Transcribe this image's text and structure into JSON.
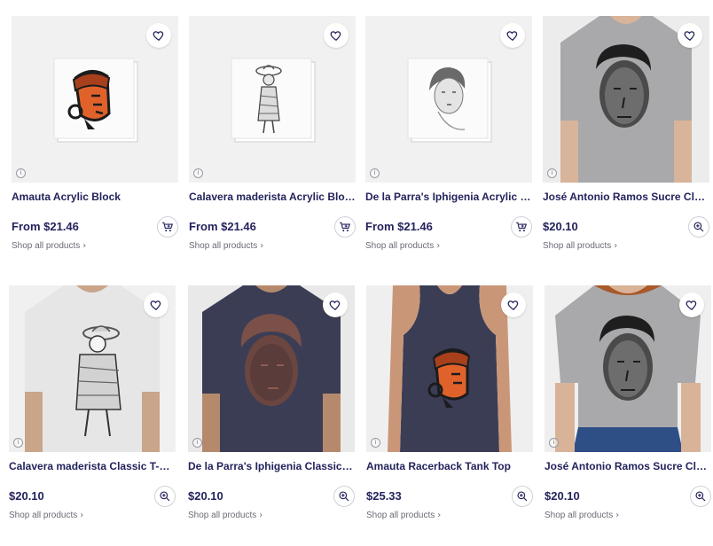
{
  "products": [
    {
      "title": "Amauta Acrylic Block",
      "price": "From $21.46",
      "link": "Shop all products",
      "action_icon": "cart-icon",
      "favorite_icon": "heart-icon",
      "info_icon": "info-icon",
      "info_glyph": "i",
      "chevron": "›",
      "art": "acrylic-amauta"
    },
    {
      "title": "Calavera maderista Acrylic Block",
      "price": "From $21.46",
      "link": "Shop all products",
      "action_icon": "cart-icon",
      "favorite_icon": "heart-icon",
      "info_icon": "info-icon",
      "info_glyph": "i",
      "chevron": "›",
      "art": "acrylic-calavera"
    },
    {
      "title": "De la Parra's Iphigenia Acrylic Bl...",
      "price": "From $21.46",
      "link": "Shop all products",
      "action_icon": "cart-icon",
      "favorite_icon": "heart-icon",
      "info_icon": "info-icon",
      "info_glyph": "i",
      "chevron": "›",
      "art": "acrylic-iphigenia"
    },
    {
      "title": "José Antonio Ramos Sucre Class...",
      "price": "$20.10",
      "link": "Shop all products",
      "action_icon": "zoom-icon",
      "favorite_icon": "heart-icon",
      "info_icon": "info-icon",
      "info_glyph": "i",
      "chevron": "›",
      "art": "tee-grey-sucre"
    },
    {
      "title": "Calavera maderista Classic T-Sh...",
      "price": "$20.10",
      "link": "Shop all products",
      "action_icon": "zoom-icon",
      "favorite_icon": "heart-icon",
      "info_icon": "info-icon",
      "info_glyph": "i",
      "chevron": "›",
      "art": "tee-white-calavera"
    },
    {
      "title": "De la Parra's Iphigenia Classic T-...",
      "price": "$20.10",
      "link": "Shop all products",
      "action_icon": "zoom-icon",
      "favorite_icon": "heart-icon",
      "info_icon": "info-icon",
      "info_glyph": "i",
      "chevron": "›",
      "art": "tee-navy-iphigenia"
    },
    {
      "title": "Amauta Racerback Tank Top",
      "price": "$25.33",
      "link": "Shop all products",
      "action_icon": "zoom-icon",
      "favorite_icon": "heart-icon",
      "info_icon": "info-icon",
      "info_glyph": "i",
      "chevron": "›",
      "art": "tank-navy-amauta"
    },
    {
      "title": "José Antonio Ramos Sucre Class...",
      "price": "$20.10",
      "link": "Shop all products",
      "action_icon": "zoom-icon",
      "favorite_icon": "heart-icon",
      "info_icon": "info-icon",
      "info_glyph": "i",
      "chevron": "›",
      "art": "tee-grey-sucre-female"
    }
  ],
  "colors": {
    "text": "#23235c",
    "muted": "#6a6a78",
    "thumb_bg": "#f1f1f2",
    "navy_shirt": "#3b3d55",
    "grey_shirt": "#a9a9ab",
    "orange_art": "#e0622a"
  }
}
